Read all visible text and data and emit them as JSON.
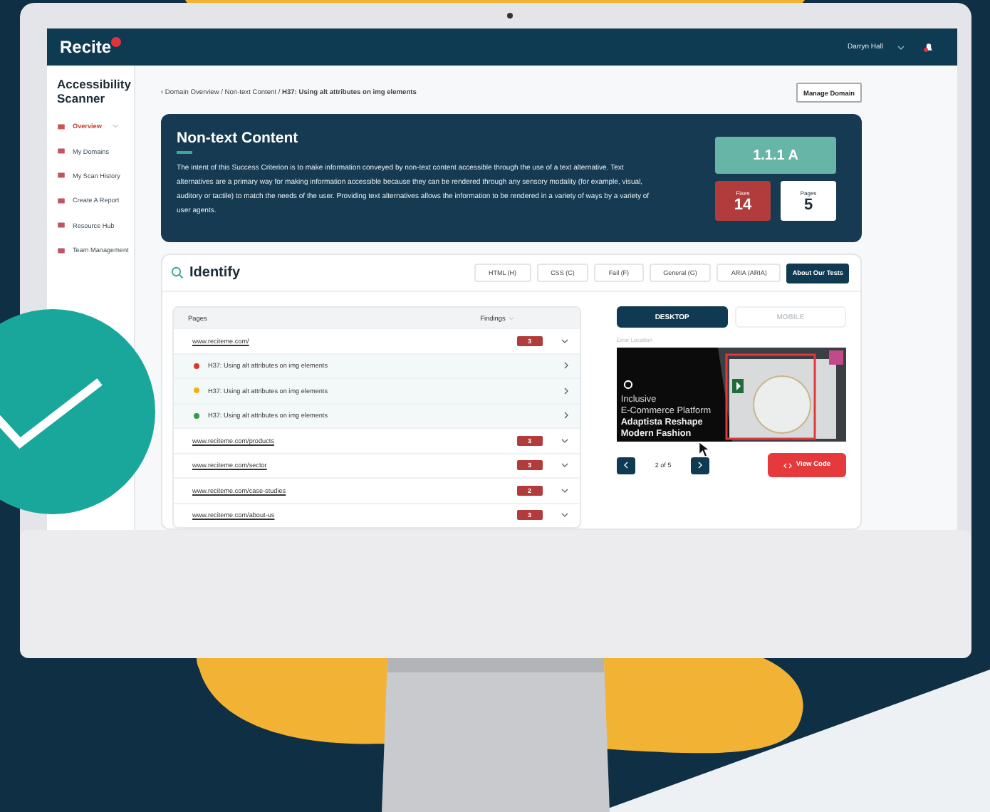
{
  "header": {
    "logo": "Recite",
    "user": "Darryn Hall"
  },
  "sidebar": {
    "title": "Accessibility Scanner",
    "items": [
      {
        "label": "Overview",
        "selected": true,
        "submenu": true
      },
      {
        "label": "My Domains",
        "selected": false,
        "submenu": false
      },
      {
        "label": "My Scan History",
        "selected": false,
        "submenu": false
      },
      {
        "label": "Create A Report",
        "selected": false,
        "submenu": false
      },
      {
        "label": "Resource Hub",
        "selected": false,
        "submenu": false
      },
      {
        "label": "Team Management",
        "selected": false,
        "submenu": false
      }
    ]
  },
  "breadcrumb": "‹ Domain Overview / Non-text Content / **H37: Using alt attributes on img elements**",
  "manage_button": "Manage Domain",
  "criterion": {
    "title": "Non-text Content",
    "description": "The intent of this Success Criterion is to make information conveyed by non-text content accessible through the use of a text alternative. Text alternatives are a primary way for making information accessible because they can be rendered through any sensory modality (for example, visual, auditory or tactile) to match the needs of the user. Providing text alternatives allows the information to be rendered in a variety of ways by a variety of user agents.",
    "level": "1.1.1 A",
    "fixes": {
      "label": "Fixes",
      "value": "14"
    },
    "pages": {
      "label": "Pages",
      "value": "5"
    }
  },
  "identify": {
    "title": "Identify",
    "filters": [
      {
        "label": "HTML (H)",
        "selected": false
      },
      {
        "label": "CSS (C)",
        "selected": false
      },
      {
        "label": "Fail (F)",
        "selected": false
      },
      {
        "label": "General (G)",
        "selected": false
      },
      {
        "label": "ARIA (ARIA)",
        "selected": false
      }
    ],
    "about_button": "About Our Tests"
  },
  "table": {
    "columns": [
      "Pages",
      "Findings"
    ],
    "rows": [
      {
        "kind": "page",
        "text": "www.reciteme.com/",
        "count": "3"
      },
      {
        "kind": "finding",
        "text": "H37: Using alt attributes on img elements",
        "color": "#d63a2f"
      },
      {
        "kind": "finding",
        "text": "H37: Using alt attributes on img elements",
        "color": "#f2b11c"
      },
      {
        "kind": "finding",
        "text": "H37: Using alt attributes on img elements",
        "color": "#2f9e44"
      },
      {
        "kind": "page",
        "text": "www.reciteme.com/products",
        "count": "3"
      },
      {
        "kind": "page",
        "text": "www.reciteme.com/sector",
        "count": "3"
      },
      {
        "kind": "page",
        "text": "www.reciteme.com/case-studies",
        "count": "2"
      },
      {
        "kind": "page",
        "text": "www.reciteme.com/about-us",
        "count": "3"
      }
    ]
  },
  "preview": {
    "tabs": [
      {
        "label": "DESKTOP",
        "selected": true
      },
      {
        "label": "MOBILE",
        "selected": false
      }
    ],
    "caption": "Error Location",
    "screenshot": {
      "lines": [
        "Inclusive",
        "E-Commerce Platform"
      ],
      "bold_lines": [
        "Adaptista Reshape",
        "Modern Fashion"
      ]
    },
    "pager": "2 of 5",
    "view_code": "View Code"
  }
}
